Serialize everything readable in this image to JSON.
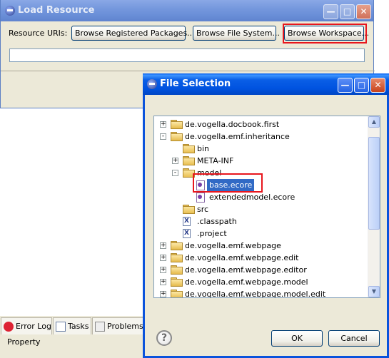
{
  "load_resource": {
    "title": "Load Resource",
    "uris_label": "Resource URIs:",
    "browse_registered": "Browse Registered Packages...",
    "browse_file_system": "Browse File System...",
    "browse_workspace": "Browse Workspace...",
    "uri_value": ""
  },
  "bottom_tabs": [
    {
      "label": "Error Log",
      "icon": "error-log-icon"
    },
    {
      "label": "Tasks",
      "icon": "tasks-icon"
    },
    {
      "label": "Problems",
      "icon": "problems-icon"
    }
  ],
  "property_label": "Property",
  "file_selection": {
    "title": "File Selection",
    "tree": [
      {
        "label": "de.vogella.docbook.first",
        "expander": "+",
        "icon": "project-folder-icon"
      },
      {
        "label": "de.vogella.emf.inheritance",
        "expander": "-",
        "icon": "project-folder-icon"
      },
      {
        "label": "bin",
        "expander": "",
        "icon": "folder-icon"
      },
      {
        "label": "META-INF",
        "expander": "+",
        "icon": "folder-icon"
      },
      {
        "label": "model",
        "expander": "-",
        "icon": "folder-icon"
      },
      {
        "label": "base.ecore",
        "expander": "",
        "icon": "ecore-file-icon",
        "selected": true
      },
      {
        "label": "extendedmodel.ecore",
        "expander": "",
        "icon": "ecore-file-icon"
      },
      {
        "label": "src",
        "expander": "",
        "icon": "folder-icon"
      },
      {
        "label": ".classpath",
        "expander": "",
        "icon": "xml-file-icon"
      },
      {
        "label": ".project",
        "expander": "",
        "icon": "xml-file-icon"
      },
      {
        "label": "de.vogella.emf.webpage",
        "expander": "+",
        "icon": "project-folder-icon"
      },
      {
        "label": "de.vogella.emf.webpage.edit",
        "expander": "+",
        "icon": "project-folder-icon"
      },
      {
        "label": "de.vogella.emf.webpage.editor",
        "expander": "+",
        "icon": "project-folder-icon"
      },
      {
        "label": "de.vogella.emf.webpage.model",
        "expander": "+",
        "icon": "project-folder-icon"
      },
      {
        "label": "de.vogella.emf.webpage.model.edit",
        "expander": "+",
        "icon": "project-folder-icon"
      }
    ],
    "ok_label": "OK",
    "cancel_label": "Cancel",
    "help_glyph": "?"
  },
  "colors": {
    "highlight": "#e8161d",
    "selection": "#316ac5",
    "titlebar_active": "#0053e0",
    "dialog_bg": "#ece9d8"
  }
}
